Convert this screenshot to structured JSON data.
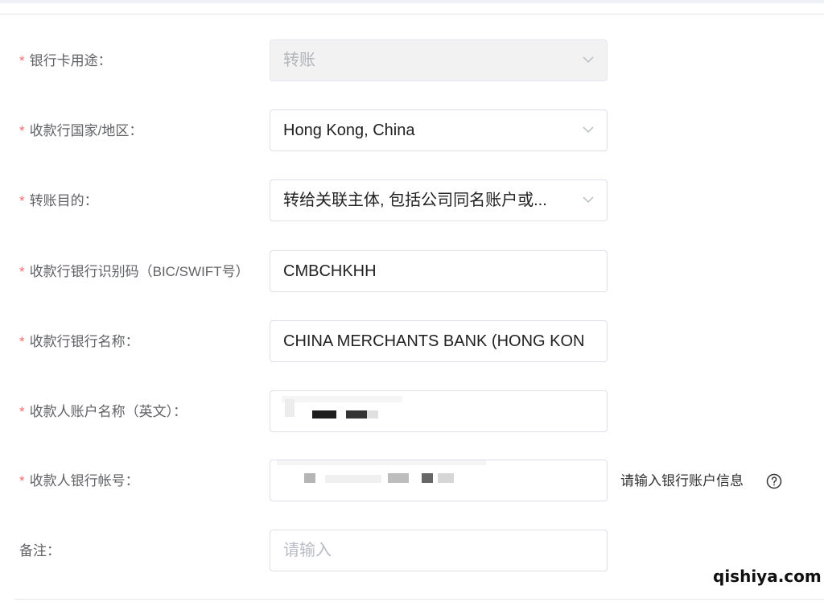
{
  "form": {
    "rows": [
      {
        "label": "银行卡用途：",
        "required": true,
        "value": "转账",
        "type": "select",
        "disabled": true
      },
      {
        "label": "收款行国家/地区：",
        "required": true,
        "value": "Hong Kong, China",
        "type": "select"
      },
      {
        "label": "转账目的：",
        "required": true,
        "value": "转给关联主体, 包括公司同名账户或...",
        "type": "select"
      },
      {
        "label": "收款行银行识别码（BIC/SWIFT号）",
        "required": true,
        "value": "CMBCHKHH",
        "type": "input"
      },
      {
        "label": "收款行银行名称：",
        "required": true,
        "value": "CHINA MERCHANTS BANK (HONG KON",
        "type": "input"
      },
      {
        "label": "收款人账户名称（英文）：",
        "required": true,
        "value": "",
        "type": "input",
        "redacted": true
      },
      {
        "label": "收款人银行帐号：",
        "required": true,
        "value": "",
        "type": "input",
        "redacted": true
      },
      {
        "label": "备注：",
        "required": false,
        "placeholder": "请输入",
        "type": "input"
      }
    ],
    "required_mark": "*",
    "account_hint": "请输入银行账户信息",
    "help_icon": "question-circle-icon"
  },
  "watermark": "qishiya.com",
  "colors": {
    "required": "#f56c6c",
    "label": "#606266",
    "border": "#dcdfe6",
    "disabled_bg": "#f2f2f2"
  }
}
